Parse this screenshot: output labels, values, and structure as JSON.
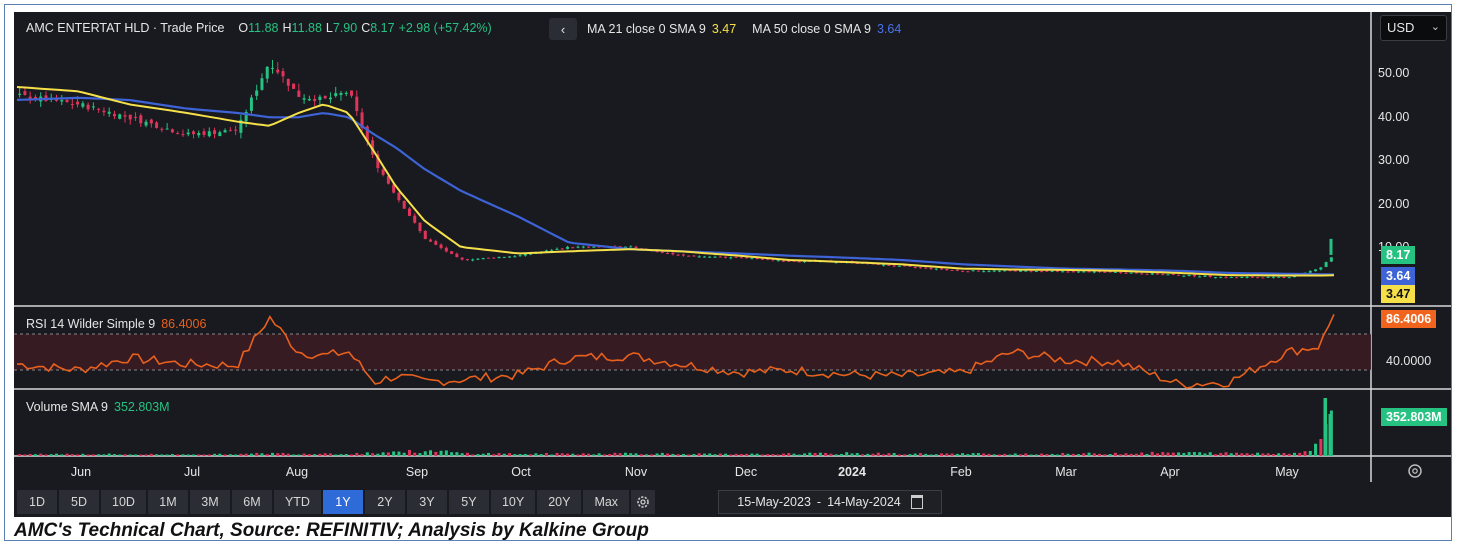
{
  "header": {
    "instrument": "AMC ENTERTAT HLD · Trade Price",
    "o_label": "O",
    "o_value": "11.88",
    "h_label": "H",
    "h_value": "11.88",
    "l_label": "L",
    "l_value": "7.90",
    "c_label": "C",
    "c_value": "8.17",
    "change": "+2.98 (+57.42%)",
    "collapse_icon": "chevron-left-icon",
    "ma21_label": "MA 21 close 0 SMA 9",
    "ma21_value": "3.47",
    "ma50_label": "MA 50 close 0 SMA 9",
    "ma50_value": "3.64",
    "currency": "USD"
  },
  "price_axis": {
    "ticks": [
      "50.00",
      "40.00",
      "30.00",
      "20.00",
      "10.00"
    ]
  },
  "price_tags": {
    "last": "8.17",
    "ma50": "3.64",
    "ma21": "3.47"
  },
  "rsi": {
    "label": "RSI 14 Wilder Simple 9",
    "value": "86.4006",
    "tick": "40.0000",
    "tag": "86.4006"
  },
  "volume": {
    "label": "Volume SMA 9",
    "value": "352.803M",
    "tag": "352.803M"
  },
  "time_axis": {
    "labels": [
      "Jun",
      "Jul",
      "Aug",
      "Sep",
      "Oct",
      "Nov",
      "Dec",
      "2024",
      "Feb",
      "Mar",
      "Apr",
      "May"
    ]
  },
  "range_buttons": [
    "1D",
    "5D",
    "10D",
    "1M",
    "3M",
    "6M",
    "YTD",
    "1Y",
    "2Y",
    "3Y",
    "5Y",
    "10Y",
    "20Y",
    "Max"
  ],
  "active_range": "1Y",
  "date_range": {
    "from": "15-May-2023",
    "separator": "-",
    "to": "14-May-2024",
    "icon": "calendar-icon"
  },
  "settings_icon": "gear-icon",
  "axis_settings_icon": "settings-icon",
  "caption": "AMC's Technical Chart, Source: REFINITIV; Analysis by Kalkine Group",
  "colors": {
    "up": "#26c281",
    "down": "#e0345a",
    "ma21": "#f5e04a",
    "ma50": "#3d63d6",
    "rsi": "#e8601c",
    "background": "#181a1f",
    "accent": "#2f6bd8"
  },
  "chart_data": {
    "type": "line",
    "title": "AMC ENTERTAT HLD · Trade Price",
    "x": [
      "2023-05-15",
      "2023-06-01",
      "2023-06-15",
      "2023-07-01",
      "2023-07-15",
      "2023-07-24",
      "2023-08-01",
      "2023-08-08",
      "2023-08-15",
      "2023-08-22",
      "2023-08-28",
      "2023-09-05",
      "2023-09-15",
      "2023-10-01",
      "2023-10-15",
      "2023-11-01",
      "2023-11-15",
      "2023-12-01",
      "2023-12-15",
      "2024-01-01",
      "2024-01-15",
      "2024-02-01",
      "2024-02-15",
      "2024-03-01",
      "2024-03-15",
      "2024-04-01",
      "2024-04-15",
      "2024-05-01",
      "2024-05-10",
      "2024-05-14"
    ],
    "series": [
      {
        "name": "Trade Price",
        "values": [
          45,
          43,
          40,
          36,
          37,
          53,
          45,
          44,
          46,
          30,
          22,
          12,
          7,
          8,
          10,
          10,
          8,
          7.5,
          6.8,
          6.5,
          5.5,
          4.5,
          4.5,
          4.3,
          4.2,
          3.5,
          3,
          3,
          5,
          8.17
        ]
      },
      {
        "name": "MA 21 close 0 SMA 9",
        "values": [
          47,
          46,
          43,
          41,
          39,
          38,
          41,
          43,
          41,
          32,
          24,
          16,
          10,
          8.5,
          9,
          9.5,
          9,
          8,
          7,
          6.5,
          6,
          5,
          4.8,
          4.7,
          4.5,
          4,
          3.5,
          3.4,
          3.4,
          3.47
        ]
      },
      {
        "name": "MA 50 close 0 SMA 9",
        "values": [
          44,
          44.5,
          44,
          42,
          41,
          40,
          40,
          41,
          40,
          36,
          33,
          28,
          23,
          17,
          11,
          9.5,
          9,
          8.5,
          8,
          7.5,
          7,
          6,
          5.5,
          5,
          4.8,
          4.5,
          4,
          3.8,
          3.7,
          3.64
        ]
      }
    ],
    "yticks": [
      10,
      20,
      30,
      40,
      50
    ],
    "ylim": [
      0,
      56
    ],
    "rsi": {
      "label": "RSI 14 Wilder Simple 9",
      "last": 86.4006,
      "values": [
        45,
        40,
        50,
        45,
        44,
        84,
        55,
        52,
        55,
        30,
        35,
        30,
        32,
        36,
        50,
        52,
        45,
        38,
        40,
        36,
        35,
        38,
        55,
        48,
        47,
        28,
        30,
        55,
        60,
        86.4
      ]
    },
    "volume": {
      "label": "Volume SMA 9",
      "last": "352.803M",
      "relative_heights": [
        0.03,
        0.04,
        0.03,
        0.03,
        0.03,
        0.05,
        0.04,
        0.05,
        0.04,
        0.06,
        0.08,
        0.12,
        0.05,
        0.04,
        0.04,
        0.05,
        0.04,
        0.03,
        0.04,
        0.05,
        0.04,
        0.04,
        0.04,
        0.04,
        0.05,
        0.06,
        0.05,
        0.05,
        0.3,
        1.0
      ]
    },
    "grid": false,
    "legend_position": "top-left"
  }
}
